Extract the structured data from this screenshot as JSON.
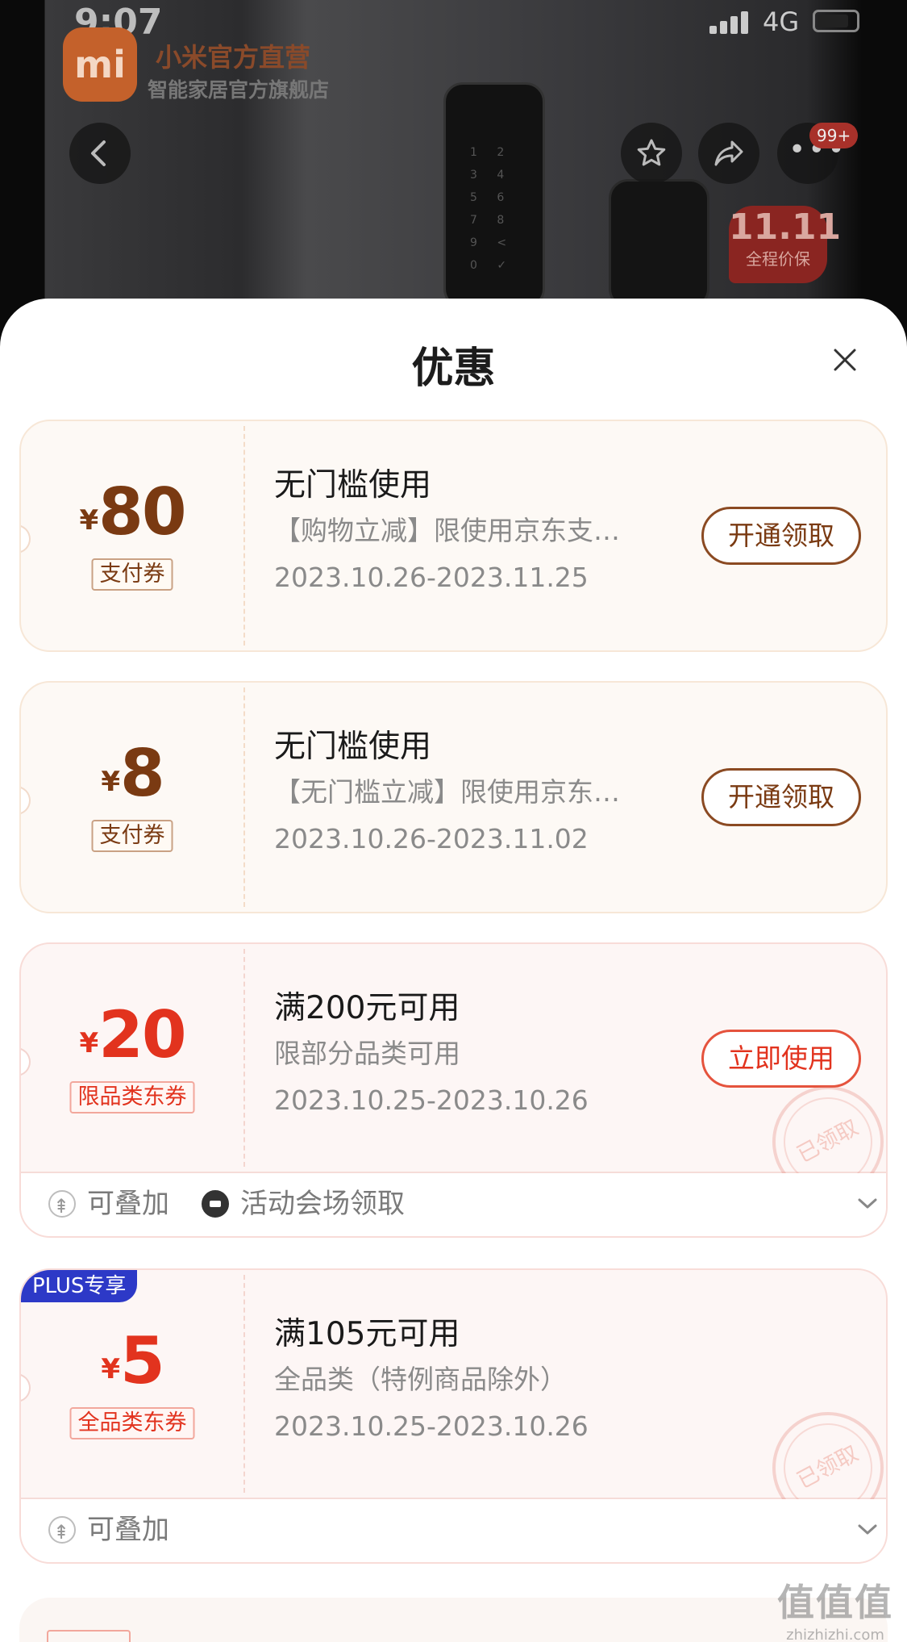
{
  "status_bar": {
    "time": "9:07",
    "network": "4G"
  },
  "shop": {
    "logo_text": "mi",
    "name": "小米官方直营",
    "subtitle": "智能家居官方旗舰店"
  },
  "top_actions": {
    "more_badge": "99+"
  },
  "promo": {
    "big": "11.11",
    "small": "全程价保"
  },
  "sheet": {
    "title": "优惠"
  },
  "coupons": [
    {
      "currency": "¥",
      "amount": "80",
      "type": "支付券",
      "condition": "无门槛使用",
      "description": "【购物立减】限使用京东支…",
      "date_range": "2023.10.26-2023.11.25",
      "action": "开通领取"
    },
    {
      "currency": "¥",
      "amount": "8",
      "type": "支付券",
      "condition": "无门槛使用",
      "description": "【无门槛立减】限使用京东…",
      "date_range": "2023.10.26-2023.11.02",
      "action": "开通领取"
    },
    {
      "currency": "¥",
      "amount": "20",
      "type": "限品类东券",
      "condition": "满200元可用",
      "description": "限部分品类可用",
      "date_range": "2023.10.25-2023.10.26",
      "action": "立即使用",
      "stamp": "已领取",
      "footer": {
        "stackable": "可叠加",
        "source": "活动会场领取"
      }
    },
    {
      "badge": "PLUS专享",
      "currency": "¥",
      "amount": "5",
      "type": "全品类东券",
      "condition": "满105元可用",
      "description": "全品类（特例商品除外）",
      "date_range": "2023.10.25-2023.10.26",
      "stamp": "已领取",
      "footer": {
        "stackable": "可叠加"
      }
    }
  ],
  "watermark": {
    "icons": "值值值",
    "url": "zhizhizhi.com"
  },
  "colors": {
    "accent_brown": "#7a3a12",
    "accent_red": "#e2331e",
    "plus_blue": "#2d39c7",
    "coupon_orange_bg": "#fdf9f5",
    "coupon_red_bg": "#fdf6f5"
  },
  "icons": [
    "back-icon",
    "star-icon",
    "share-icon",
    "more-icon",
    "close-icon",
    "stack-icon",
    "ticket-icon",
    "chevron-down-icon"
  ]
}
